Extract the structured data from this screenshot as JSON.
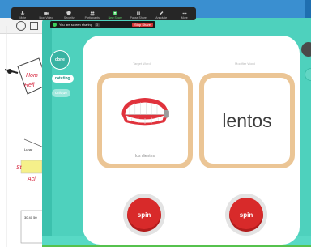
{
  "zoom_toolbar": {
    "items": [
      {
        "label": "Mute"
      },
      {
        "label": "Stop Video"
      },
      {
        "label": "Security"
      },
      {
        "label": "Participants"
      },
      {
        "label": "New Share"
      },
      {
        "label": "Pause Share"
      },
      {
        "label": "Annotate"
      },
      {
        "label": "More"
      }
    ],
    "share_status": "You are screen sharing",
    "share_chip": "3",
    "stop_label": "Stop Share"
  },
  "whiteboard": {
    "notes": [
      "Hom",
      "Refl",
      "Lunar",
      "St",
      "Acl",
      "30 40 50"
    ]
  },
  "app": {
    "done_label": "done",
    "mode_active": "rotating",
    "mode_inactive": "unique",
    "left_column_label": "Target Word",
    "right_column_label": "Modifier Word",
    "left_card_caption": "los dientes",
    "right_card_word": "lentos",
    "spin_label": "spin"
  },
  "colors": {
    "teal": "#4ed1bd",
    "card_border": "#ebc595",
    "spin_red": "#d82a2a"
  }
}
